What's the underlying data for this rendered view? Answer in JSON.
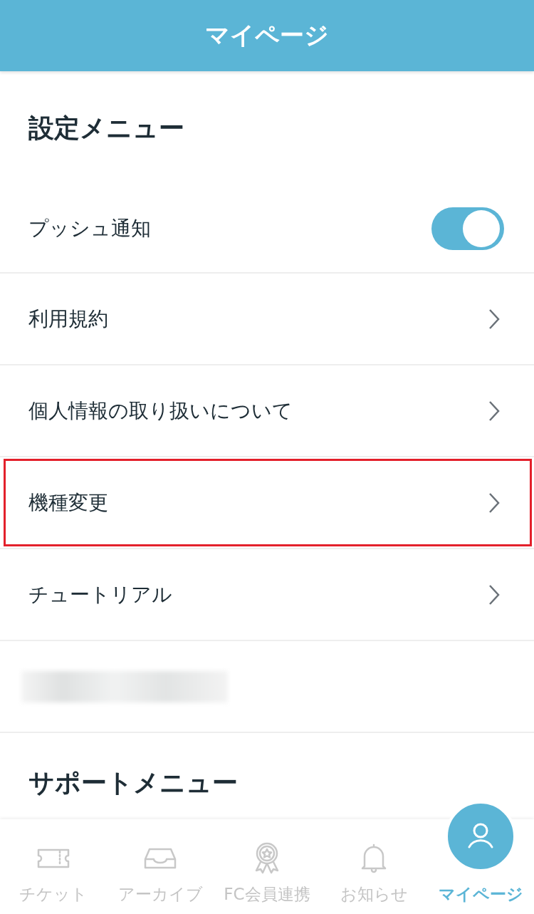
{
  "header": {
    "title": "マイページ"
  },
  "settings": {
    "title": "設定メニュー",
    "rows": [
      {
        "kind": "toggle",
        "label": "プッシュ通知",
        "on": true,
        "highlighted": false
      },
      {
        "kind": "link",
        "label": "利用規約",
        "highlighted": false
      },
      {
        "kind": "link",
        "label": "個人情報の取り扱いについて",
        "highlighted": false
      },
      {
        "kind": "link",
        "label": "機種変更",
        "highlighted": true
      },
      {
        "kind": "link",
        "label": "チュートリアル",
        "highlighted": false
      },
      {
        "kind": "redacted",
        "highlighted": false
      }
    ]
  },
  "support": {
    "title": "サポートメニュー"
  },
  "tab_bar": [
    {
      "label": "チケット",
      "selected": false
    },
    {
      "label": "アーカイブ",
      "selected": false
    },
    {
      "label": "FC会員連携",
      "selected": false
    },
    {
      "label": "お知らせ",
      "selected": false
    },
    {
      "label": "マイページ",
      "selected": true
    }
  ]
}
